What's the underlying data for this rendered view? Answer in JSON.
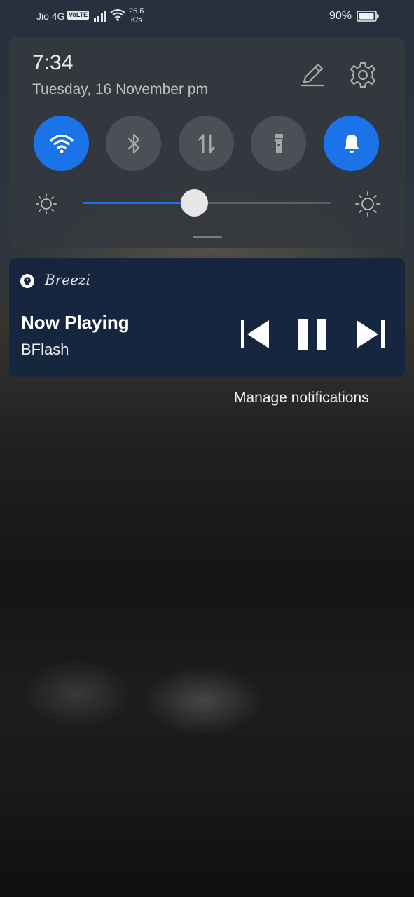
{
  "status_bar": {
    "carrier": "Jio 4G",
    "volte": "VoLTE",
    "speed_value": "25.6",
    "speed_unit": "K/s",
    "battery": "90%"
  },
  "quick_settings": {
    "time": "7:34",
    "date": "Tuesday, 16 November  pm",
    "toggles": [
      {
        "name": "wifi",
        "icon": "wifi-icon",
        "state": "on"
      },
      {
        "name": "bluetooth",
        "icon": "bluetooth-icon",
        "state": "off"
      },
      {
        "name": "mobile-data",
        "icon": "data-transfer-icon",
        "state": "off"
      },
      {
        "name": "flashlight",
        "icon": "flashlight-icon",
        "state": "off"
      },
      {
        "name": "notification-sound",
        "icon": "bell-icon",
        "state": "on"
      }
    ],
    "brightness_level": 0.45
  },
  "media_notification": {
    "app_name": "Breezi",
    "title": "Now Playing",
    "artist": "BFlash",
    "controls": [
      "previous-icon",
      "pause-icon",
      "next-icon"
    ]
  },
  "manage_notifications": "Manage notifications",
  "colors": {
    "accent": "#1a73e8",
    "panel": "#34383e",
    "notification_bg": "#15263e"
  }
}
